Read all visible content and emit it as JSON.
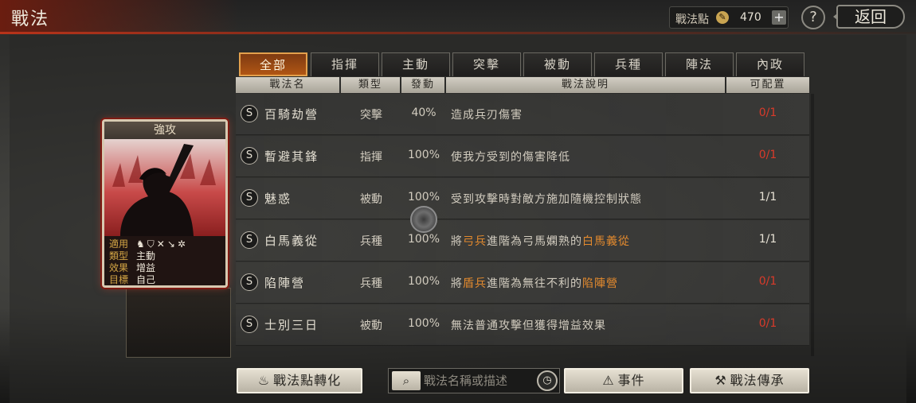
{
  "header": {
    "title": "戰法",
    "points_label": "戰法點",
    "points_value": "470",
    "help": "?",
    "back": "返回"
  },
  "card": {
    "title": "強攻",
    "rows": [
      {
        "key": "適用",
        "value": ""
      },
      {
        "key": "類型",
        "value": "主動"
      },
      {
        "key": "效果",
        "value": "增益"
      },
      {
        "key": "目標",
        "value": "自己"
      }
    ],
    "troop_icons": [
      "cavalry-icon",
      "shield-icon",
      "crossed-bow-icon",
      "spear-icon",
      "wheel-icon"
    ]
  },
  "tabs": [
    {
      "label": "全部",
      "active": true
    },
    {
      "label": "指揮",
      "active": false
    },
    {
      "label": "主動",
      "active": false
    },
    {
      "label": "突擊",
      "active": false
    },
    {
      "label": "被動",
      "active": false
    },
    {
      "label": "兵種",
      "active": false
    },
    {
      "label": "陣法",
      "active": false
    },
    {
      "label": "內政",
      "active": false
    }
  ],
  "columns": [
    "戰法名",
    "類型",
    "發動",
    "戰法說明",
    "可配置"
  ],
  "rows": [
    {
      "grade": "S",
      "name": "百騎劫營",
      "type": "突擊",
      "rate": "40%",
      "desc": [
        {
          "t": "造成兵刃傷害"
        }
      ],
      "count": "0/1",
      "count_color": "#d93a2a"
    },
    {
      "grade": "S",
      "name": "暫避其鋒",
      "type": "指揮",
      "rate": "100%",
      "desc": [
        {
          "t": "使我方受到的傷害降低"
        }
      ],
      "count": "0/1",
      "count_color": "#d93a2a"
    },
    {
      "grade": "S",
      "name": "魅惑",
      "type": "被動",
      "rate": "100%",
      "desc": [
        {
          "t": "受到攻擊時對敵方施加隨機控制狀態"
        }
      ],
      "count": "1/1",
      "count_color": "#e6e1d4"
    },
    {
      "grade": "S",
      "name": "白馬義從",
      "type": "兵種",
      "rate": "100%",
      "desc": [
        {
          "t": "將"
        },
        {
          "t": "弓兵",
          "hl": true
        },
        {
          "t": "進階為弓馬嫻熟的"
        },
        {
          "t": "白馬義從",
          "hl": true
        }
      ],
      "count": "1/1",
      "count_color": "#e6e1d4"
    },
    {
      "grade": "S",
      "name": "陷陣營",
      "type": "兵種",
      "rate": "100%",
      "desc": [
        {
          "t": "將"
        },
        {
          "t": "盾兵",
          "hl": true
        },
        {
          "t": "進階為無往不利的"
        },
        {
          "t": "陷陣營",
          "hl": true
        }
      ],
      "count": "0/1",
      "count_color": "#d93a2a"
    },
    {
      "grade": "S",
      "name": "士別三日",
      "type": "被動",
      "rate": "100%",
      "desc": [
        {
          "t": "無法普通攻擊但獲得增益效果"
        }
      ],
      "count": "0/1",
      "count_color": "#d93a2a"
    }
  ],
  "footer": {
    "convert_label": "戰法點轉化",
    "search_placeholder": "戰法名稱或描述",
    "events_label": "事件",
    "inherit_label": "戰法傳承"
  }
}
